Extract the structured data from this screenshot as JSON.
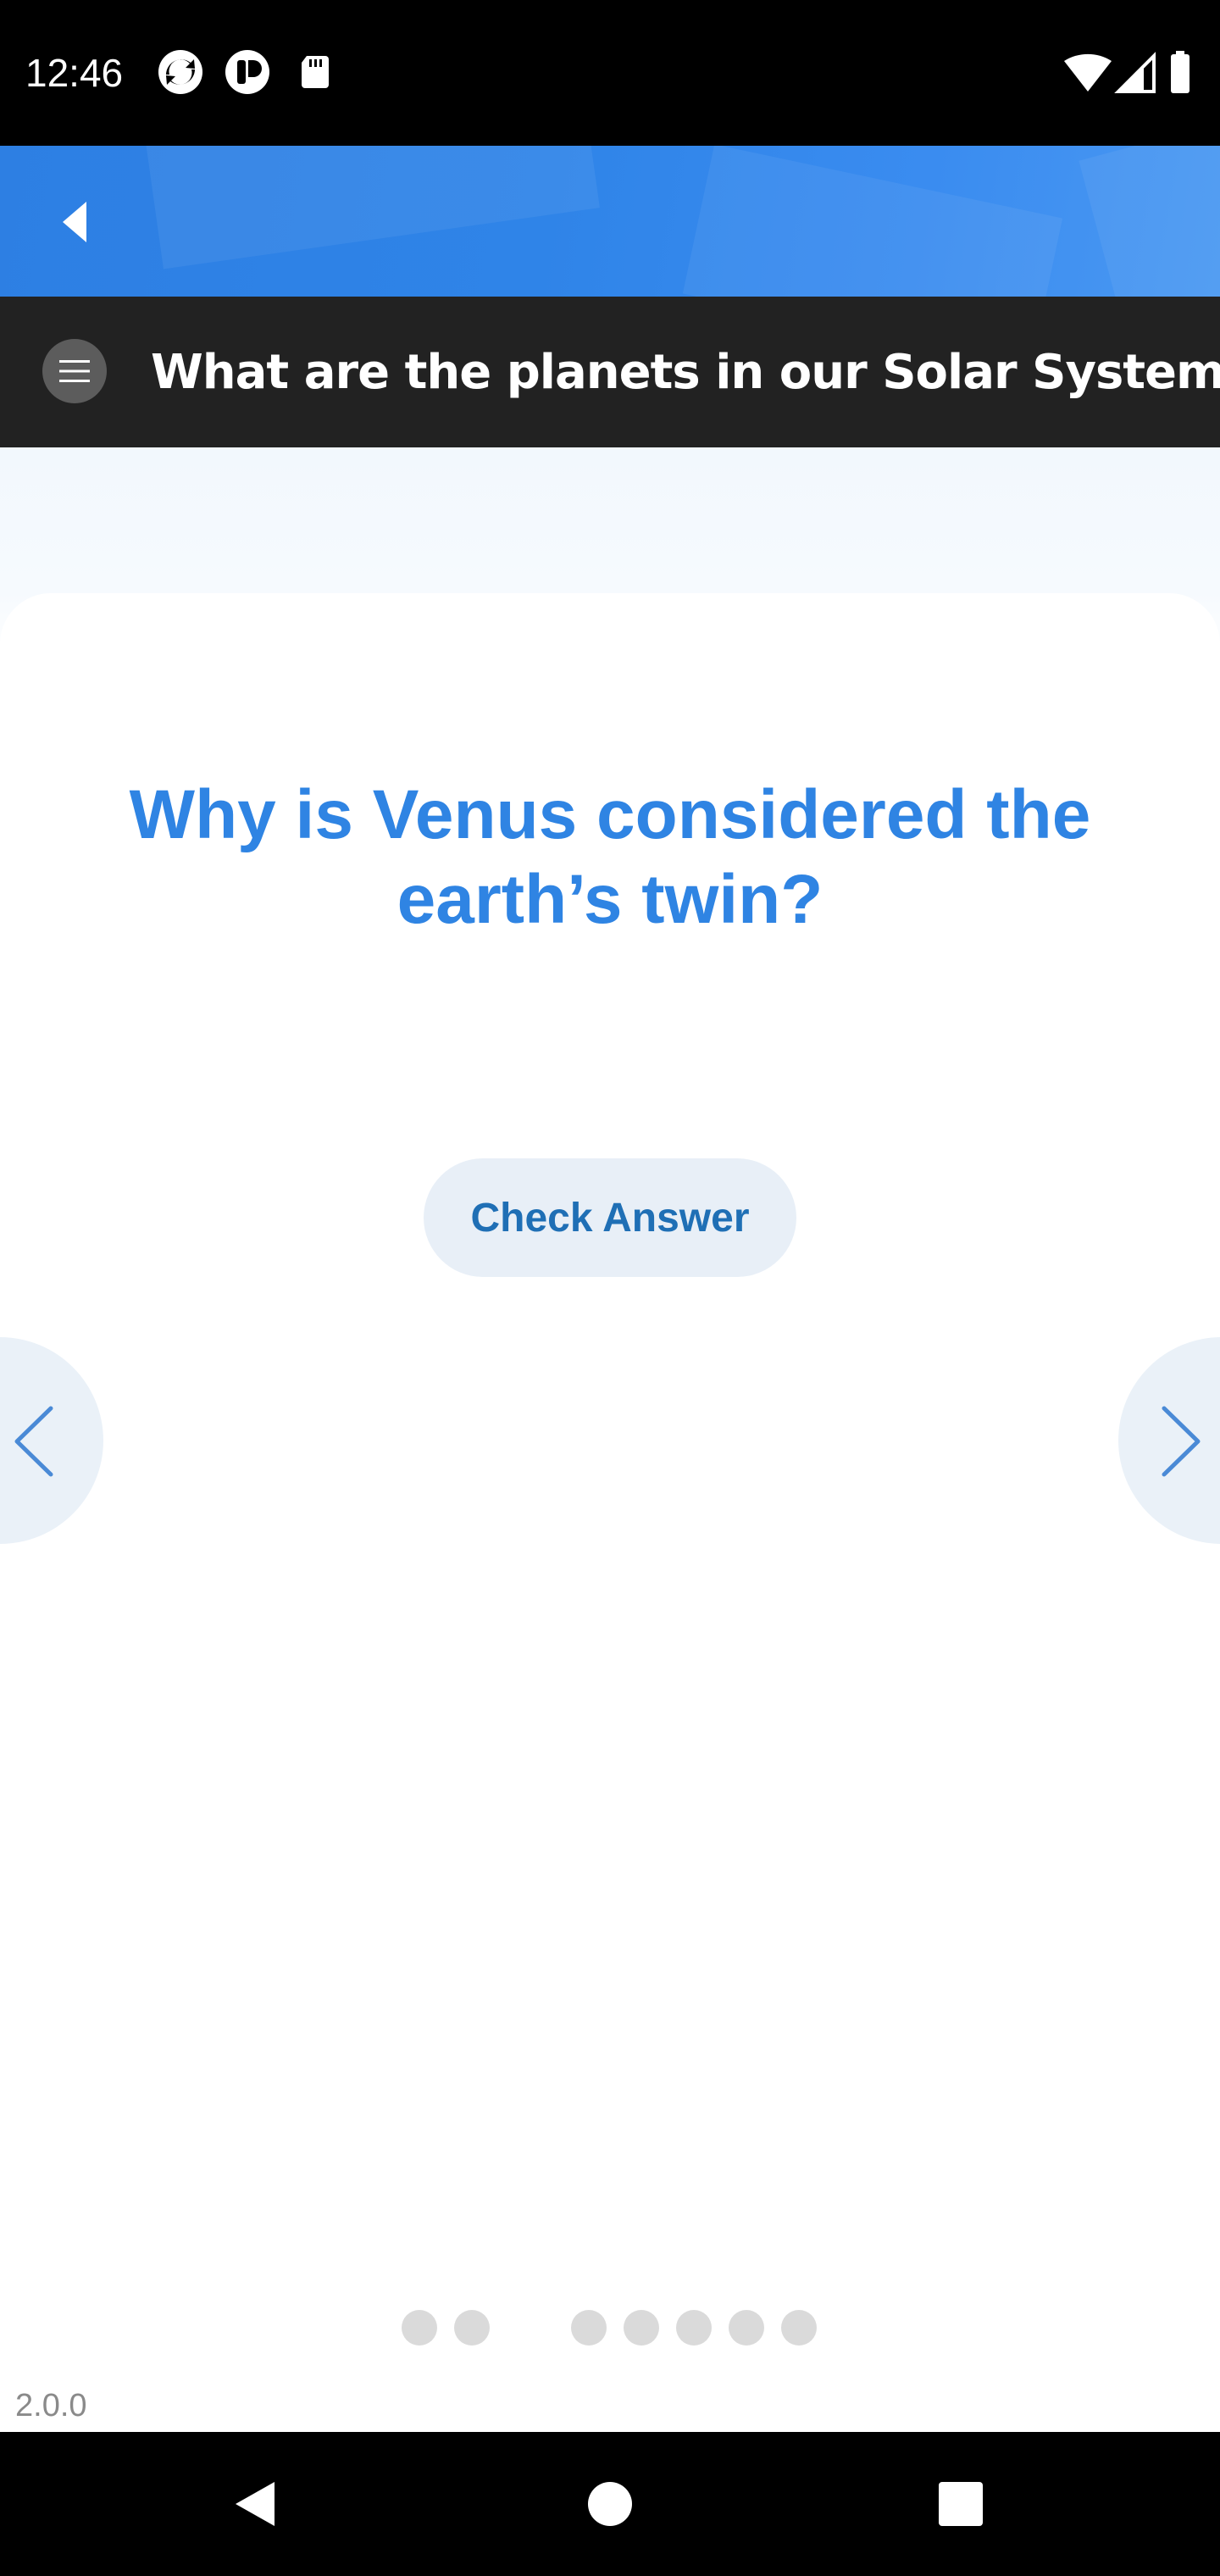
{
  "status_bar": {
    "time": "12:46",
    "left_icons": [
      "sync-app-icon",
      "pocket-app-icon",
      "sd-card-icon"
    ],
    "right_icons": [
      "wifi-icon",
      "cell-signal-icon",
      "battery-icon"
    ]
  },
  "header": {
    "back_icon": "back-arrow-icon",
    "accent_color": "#2f84e8"
  },
  "topic_bar": {
    "menu_icon": "hamburger-menu-icon",
    "title": "What are the planets in our Solar System?"
  },
  "card": {
    "question": "Why is Venus considered the earth’s twin?",
    "check_answer_label": "Check Answer",
    "question_color": "#2f84e3"
  },
  "navigation": {
    "prev_icon": "chevron-left-icon",
    "next_icon": "chevron-right-icon"
  },
  "pagination": {
    "dot_count": 7
  },
  "footer": {
    "version": "2.0.0"
  },
  "system_nav": {
    "back": "system-back-icon",
    "home": "system-home-icon",
    "recents": "system-recents-icon"
  }
}
